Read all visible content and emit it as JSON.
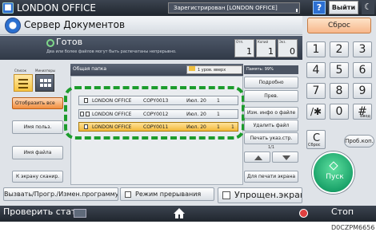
{
  "topbar": {
    "office": "LONDON OFFICE",
    "registered": "Зарегистрирован [LONDON OFFICE]",
    "help": "?",
    "logout": "Выйти"
  },
  "title": "Сервер Документов",
  "reset": "Сброс",
  "status": {
    "ready": "Готов",
    "sub": "Два или более файлов могут быть распечатаны непрерывно.",
    "counters": [
      {
        "label": "Отп.",
        "value": "1"
      },
      {
        "label": "Копий",
        "value": "1"
      },
      {
        "label": "Экз.",
        "value": "0"
      }
    ]
  },
  "left": {
    "view_label_1": "Список",
    "view_label_2": "Миниатюры",
    "display_all": "Отобразить все",
    "user_name": "Имя польз.",
    "file_name": "Имя файла",
    "to_scan": "К экрану сканир."
  },
  "list": {
    "folder": "Общая папка",
    "up_level": "1 уров. вверх",
    "rows": [
      {
        "lock": false,
        "user": "LONDON OFFICE",
        "name": "COPY0013",
        "date": "Июл. 20",
        "pages": "1",
        "order": ""
      },
      {
        "lock": true,
        "user": "LONDON OFFICE",
        "name": "COPY0012",
        "date": "Июл. 20",
        "pages": "1",
        "order": ""
      },
      {
        "lock": false,
        "user": "LONDON OFFICE",
        "name": "COPY0011",
        "date": "Июл. 20",
        "pages": "1",
        "order": "1"
      }
    ]
  },
  "right": {
    "memory": "Память: 99%",
    "details": "Подробно",
    "preview": "Прев.",
    "file_info": "Изм. инфо о файле",
    "delete_file": "Удалить файл",
    "print_spec": "Печать указ.стр.",
    "page": "1/1",
    "for_print": "Для печати экрана"
  },
  "bottom": {
    "program": "Вызвать/Прогр./Измен.программу",
    "interrupt": "Режим прерывания",
    "simple": "Упрощен.экран"
  },
  "keypad": {
    "keys": [
      "1",
      "2",
      "3",
      "4",
      "5",
      "6",
      "7",
      "8",
      "9",
      "/✱",
      "0",
      "#"
    ],
    "enter": "Ввод",
    "clear": "C",
    "clear_sub": "Сброс",
    "prog_copy": "Проб.коп.",
    "start": "Пуск"
  },
  "statusbar": {
    "check": "Проверить статус",
    "stop": "Стоп"
  },
  "code": "D0CZPM6656"
}
